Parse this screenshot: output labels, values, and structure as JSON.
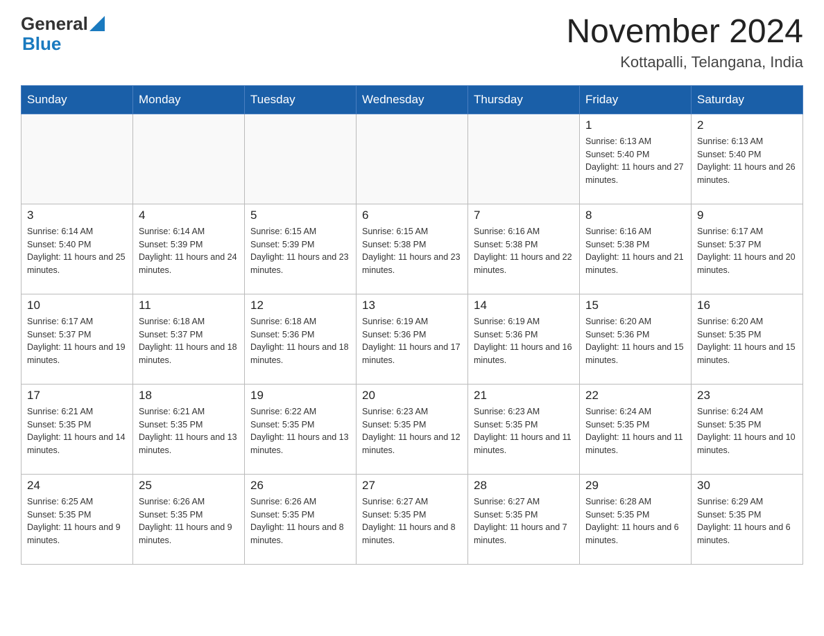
{
  "header": {
    "logo_general": "General",
    "logo_blue": "Blue",
    "month_title": "November 2024",
    "location": "Kottapalli, Telangana, India"
  },
  "weekdays": [
    "Sunday",
    "Monday",
    "Tuesday",
    "Wednesday",
    "Thursday",
    "Friday",
    "Saturday"
  ],
  "weeks": [
    [
      {
        "day": "",
        "info": ""
      },
      {
        "day": "",
        "info": ""
      },
      {
        "day": "",
        "info": ""
      },
      {
        "day": "",
        "info": ""
      },
      {
        "day": "",
        "info": ""
      },
      {
        "day": "1",
        "info": "Sunrise: 6:13 AM\nSunset: 5:40 PM\nDaylight: 11 hours and 27 minutes."
      },
      {
        "day": "2",
        "info": "Sunrise: 6:13 AM\nSunset: 5:40 PM\nDaylight: 11 hours and 26 minutes."
      }
    ],
    [
      {
        "day": "3",
        "info": "Sunrise: 6:14 AM\nSunset: 5:40 PM\nDaylight: 11 hours and 25 minutes."
      },
      {
        "day": "4",
        "info": "Sunrise: 6:14 AM\nSunset: 5:39 PM\nDaylight: 11 hours and 24 minutes."
      },
      {
        "day": "5",
        "info": "Sunrise: 6:15 AM\nSunset: 5:39 PM\nDaylight: 11 hours and 23 minutes."
      },
      {
        "day": "6",
        "info": "Sunrise: 6:15 AM\nSunset: 5:38 PM\nDaylight: 11 hours and 23 minutes."
      },
      {
        "day": "7",
        "info": "Sunrise: 6:16 AM\nSunset: 5:38 PM\nDaylight: 11 hours and 22 minutes."
      },
      {
        "day": "8",
        "info": "Sunrise: 6:16 AM\nSunset: 5:38 PM\nDaylight: 11 hours and 21 minutes."
      },
      {
        "day": "9",
        "info": "Sunrise: 6:17 AM\nSunset: 5:37 PM\nDaylight: 11 hours and 20 minutes."
      }
    ],
    [
      {
        "day": "10",
        "info": "Sunrise: 6:17 AM\nSunset: 5:37 PM\nDaylight: 11 hours and 19 minutes."
      },
      {
        "day": "11",
        "info": "Sunrise: 6:18 AM\nSunset: 5:37 PM\nDaylight: 11 hours and 18 minutes."
      },
      {
        "day": "12",
        "info": "Sunrise: 6:18 AM\nSunset: 5:36 PM\nDaylight: 11 hours and 18 minutes."
      },
      {
        "day": "13",
        "info": "Sunrise: 6:19 AM\nSunset: 5:36 PM\nDaylight: 11 hours and 17 minutes."
      },
      {
        "day": "14",
        "info": "Sunrise: 6:19 AM\nSunset: 5:36 PM\nDaylight: 11 hours and 16 minutes."
      },
      {
        "day": "15",
        "info": "Sunrise: 6:20 AM\nSunset: 5:36 PM\nDaylight: 11 hours and 15 minutes."
      },
      {
        "day": "16",
        "info": "Sunrise: 6:20 AM\nSunset: 5:35 PM\nDaylight: 11 hours and 15 minutes."
      }
    ],
    [
      {
        "day": "17",
        "info": "Sunrise: 6:21 AM\nSunset: 5:35 PM\nDaylight: 11 hours and 14 minutes."
      },
      {
        "day": "18",
        "info": "Sunrise: 6:21 AM\nSunset: 5:35 PM\nDaylight: 11 hours and 13 minutes."
      },
      {
        "day": "19",
        "info": "Sunrise: 6:22 AM\nSunset: 5:35 PM\nDaylight: 11 hours and 13 minutes."
      },
      {
        "day": "20",
        "info": "Sunrise: 6:23 AM\nSunset: 5:35 PM\nDaylight: 11 hours and 12 minutes."
      },
      {
        "day": "21",
        "info": "Sunrise: 6:23 AM\nSunset: 5:35 PM\nDaylight: 11 hours and 11 minutes."
      },
      {
        "day": "22",
        "info": "Sunrise: 6:24 AM\nSunset: 5:35 PM\nDaylight: 11 hours and 11 minutes."
      },
      {
        "day": "23",
        "info": "Sunrise: 6:24 AM\nSunset: 5:35 PM\nDaylight: 11 hours and 10 minutes."
      }
    ],
    [
      {
        "day": "24",
        "info": "Sunrise: 6:25 AM\nSunset: 5:35 PM\nDaylight: 11 hours and 9 minutes."
      },
      {
        "day": "25",
        "info": "Sunrise: 6:26 AM\nSunset: 5:35 PM\nDaylight: 11 hours and 9 minutes."
      },
      {
        "day": "26",
        "info": "Sunrise: 6:26 AM\nSunset: 5:35 PM\nDaylight: 11 hours and 8 minutes."
      },
      {
        "day": "27",
        "info": "Sunrise: 6:27 AM\nSunset: 5:35 PM\nDaylight: 11 hours and 8 minutes."
      },
      {
        "day": "28",
        "info": "Sunrise: 6:27 AM\nSunset: 5:35 PM\nDaylight: 11 hours and 7 minutes."
      },
      {
        "day": "29",
        "info": "Sunrise: 6:28 AM\nSunset: 5:35 PM\nDaylight: 11 hours and 6 minutes."
      },
      {
        "day": "30",
        "info": "Sunrise: 6:29 AM\nSunset: 5:35 PM\nDaylight: 11 hours and 6 minutes."
      }
    ]
  ]
}
